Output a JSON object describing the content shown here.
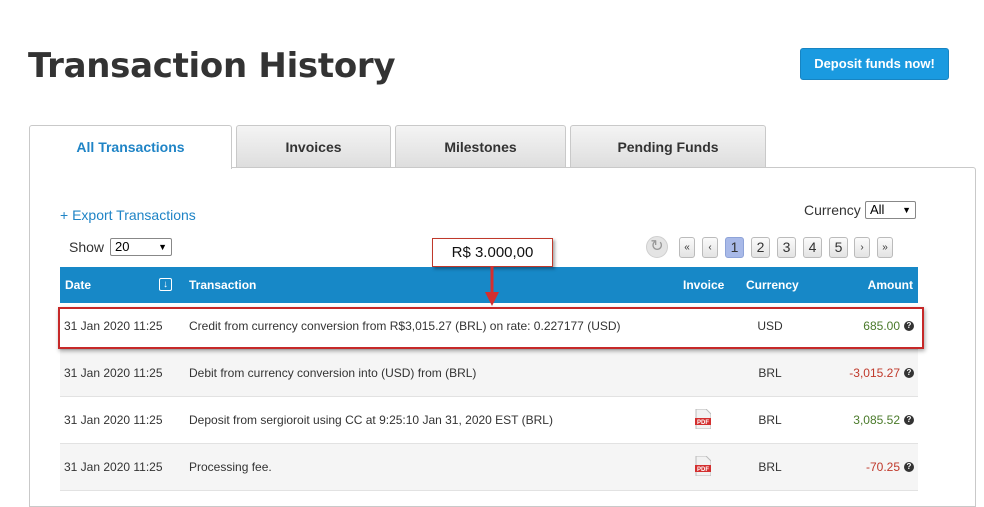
{
  "header": {
    "title": "Transaction History",
    "deposit_button": "Deposit funds now!"
  },
  "tabs": [
    {
      "label": "All Transactions",
      "active": true
    },
    {
      "label": "Invoices",
      "active": false
    },
    {
      "label": "Milestones",
      "active": false
    },
    {
      "label": "Pending Funds",
      "active": false
    }
  ],
  "toolbar": {
    "export_link": "+ Export Transactions",
    "currency_label": "Currency",
    "currency_value": "All",
    "show_label": "Show",
    "show_value": "20"
  },
  "pagination": {
    "first": "«",
    "prev": "‹",
    "pages": [
      "1",
      "2",
      "3",
      "4",
      "5"
    ],
    "current_page": "1",
    "next": "›",
    "last": "»"
  },
  "annotation": {
    "callout_text": "R$ 3.000,00",
    "accent_color": "#c62828"
  },
  "table": {
    "headers": {
      "date": "Date",
      "transaction": "Transaction",
      "invoice": "Invoice",
      "currency": "Currency",
      "amount": "Amount"
    },
    "header_color": "#1788c7",
    "rows": [
      {
        "date": "31 Jan 2020 11:25",
        "transaction": "Credit from currency conversion from R$3,015.27 (BRL) on rate: 0.227177 (USD)",
        "invoice": "",
        "currency": "USD",
        "amount": "685.00",
        "positive": true
      },
      {
        "date": "31 Jan 2020 11:25",
        "transaction": "Debit from currency conversion into (USD) from (BRL)",
        "invoice": "",
        "currency": "BRL",
        "amount": "-3,015.27",
        "positive": false
      },
      {
        "date": "31 Jan 2020 11:25",
        "transaction": "Deposit from sergioroit using CC at 9:25:10 Jan 31, 2020 EST (BRL)",
        "invoice": "pdf-icon",
        "currency": "BRL",
        "amount": "3,085.52",
        "positive": true
      },
      {
        "date": "31 Jan 2020 11:25",
        "transaction": "Processing fee.",
        "invoice": "pdf-icon",
        "currency": "BRL",
        "amount": "-70.25",
        "positive": false
      }
    ]
  }
}
